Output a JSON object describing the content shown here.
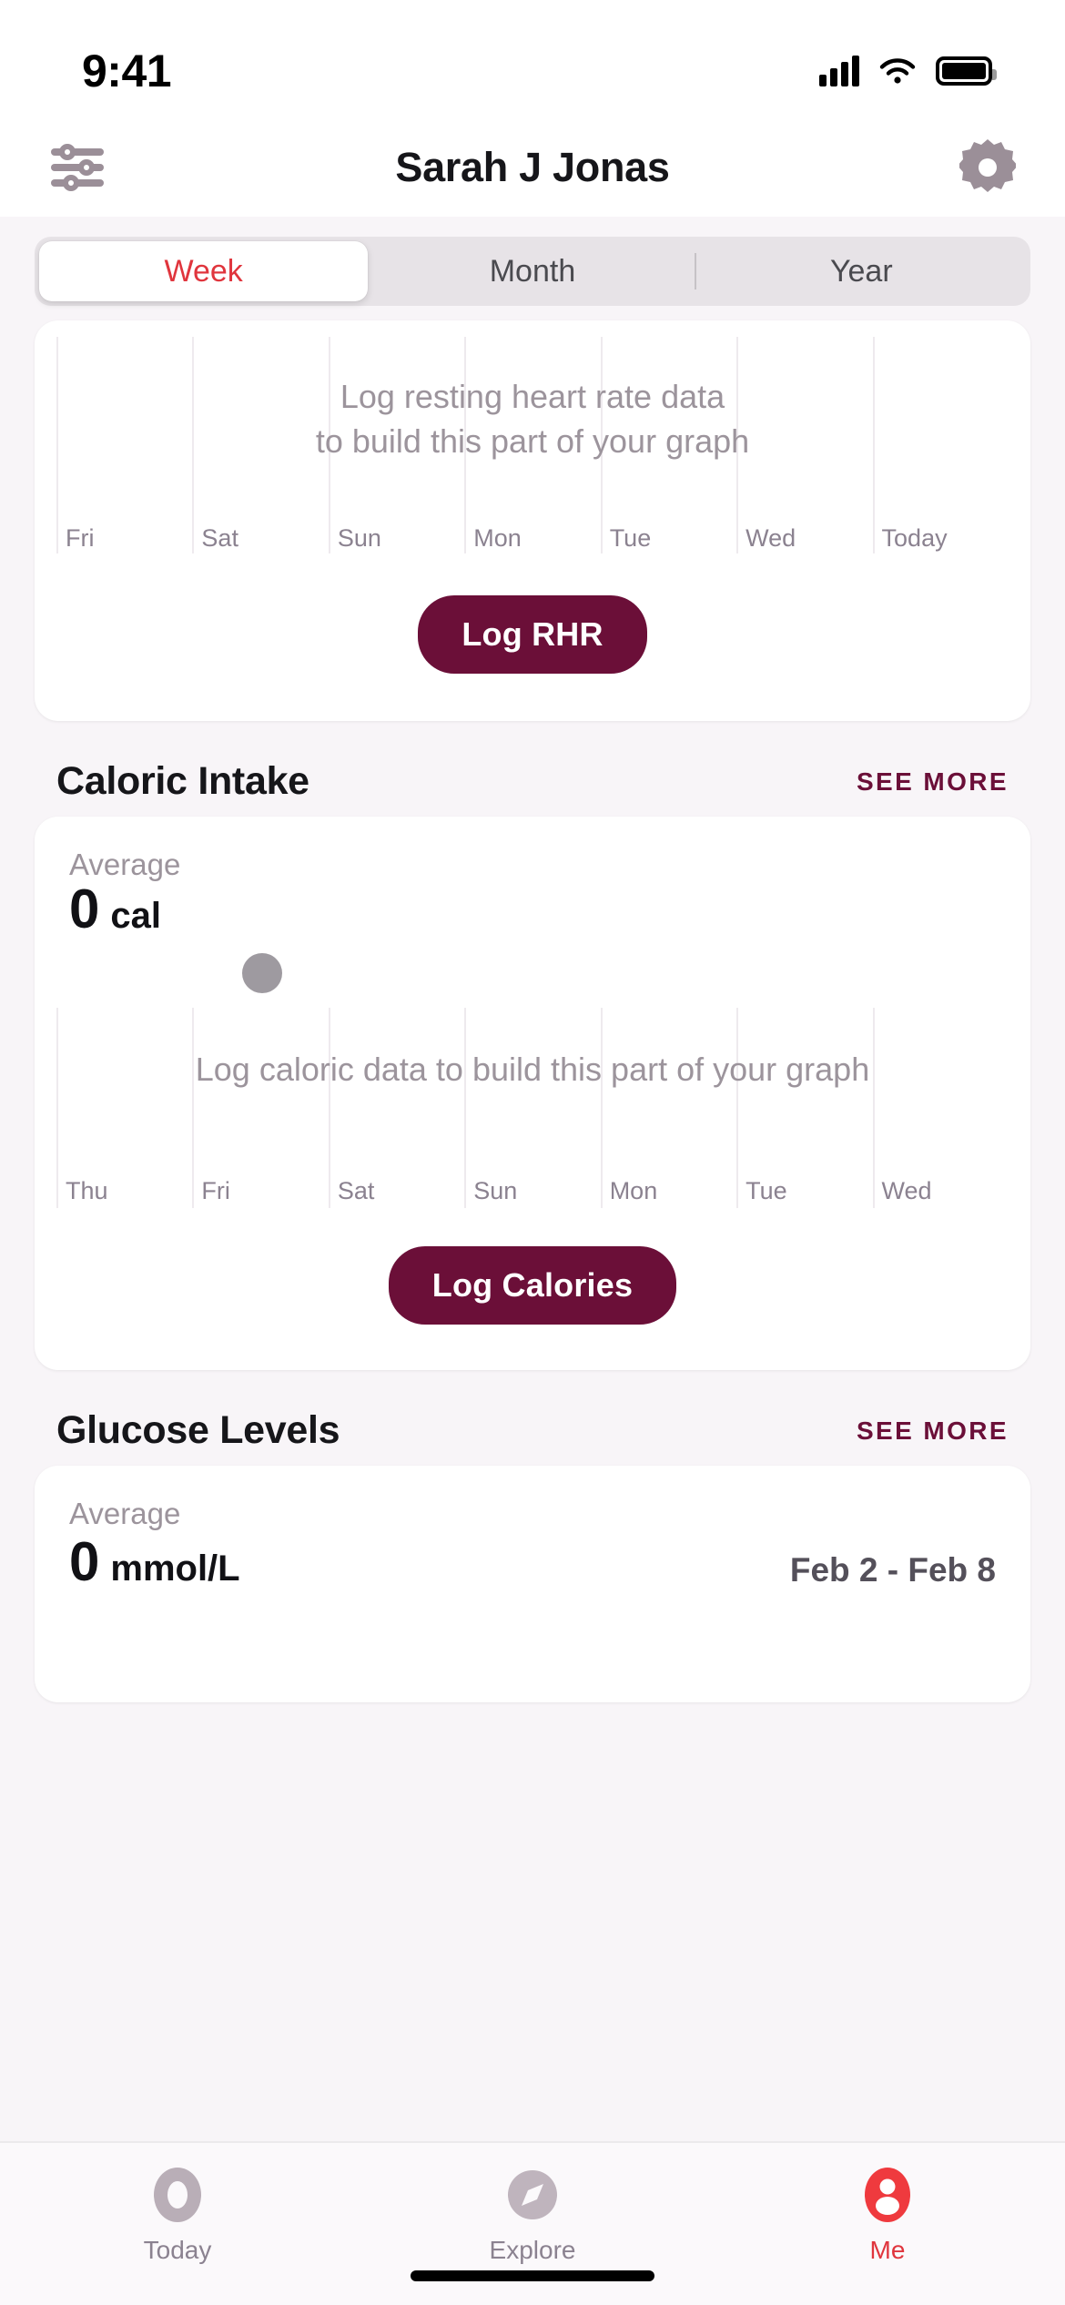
{
  "status_bar": {
    "time": "9:41",
    "signal_icon": "cellular-signal-icon",
    "wifi_icon": "wifi-icon",
    "battery_icon": "battery-icon"
  },
  "nav_bar": {
    "filter_icon": "filter-sliders-icon",
    "title": "Sarah J Jonas",
    "settings_icon": "gear-icon"
  },
  "segmented_control": {
    "options": [
      {
        "label": "Week",
        "active": true
      },
      {
        "label": "Month",
        "active": false
      },
      {
        "label": "Year",
        "active": false
      }
    ],
    "active_color": "#e0353d",
    "inactive_color": "#4a4a4f",
    "track_color": "#e7e3e7"
  },
  "cards": [
    {
      "id": "resting-heart-rate",
      "empty_message_line1": "Log resting heart rate data",
      "empty_message_line2": "to build this part of your graph",
      "day_labels": [
        "Fri",
        "Sat",
        "Sun",
        "Mon",
        "Tue",
        "Wed",
        "Today"
      ],
      "button_label": "Log RHR"
    }
  ],
  "caloric_intake": {
    "section_title": "Caloric Intake",
    "see_more_label": "SEE MORE",
    "average_label": "Average",
    "average_value": "0",
    "average_unit": "cal",
    "empty_message": "Log caloric data to build this part of your graph",
    "day_labels": [
      "Thu",
      "Fri",
      "Sat",
      "Sun",
      "Mon",
      "Tue",
      "Wed"
    ],
    "button_label": "Log Calories"
  },
  "glucose_levels": {
    "section_title": "Glucose Levels",
    "see_more_label": "SEE MORE",
    "average_label": "Average",
    "average_value": "0",
    "average_unit": "mmol/L",
    "date_range": "Feb 2 - Feb 8"
  },
  "tab_bar": {
    "tabs": [
      {
        "label": "Today",
        "icon": "ring-icon",
        "active": false
      },
      {
        "label": "Explore",
        "icon": "compass-icon",
        "active": false
      },
      {
        "label": "Me",
        "icon": "person-circle-icon",
        "active": true
      }
    ],
    "active_color": "#e0353d",
    "inactive_color": "#b3a9b3"
  },
  "theme": {
    "accent_maroon": "#6b0f38",
    "accent_red": "#e0353d",
    "page_background": "#f8f5f8",
    "card_background": "#ffffff",
    "muted_text": "#9c949c"
  },
  "chart_data": [
    {
      "type": "line",
      "title": "Resting Heart Rate",
      "categories": [
        "Fri",
        "Sat",
        "Sun",
        "Mon",
        "Tue",
        "Wed",
        "Today"
      ],
      "values": [
        null,
        null,
        null,
        null,
        null,
        null,
        null
      ],
      "xlabel": "",
      "ylabel": "",
      "grid": true,
      "empty_state": true,
      "empty_message": "Log resting heart rate data to build this part of your graph"
    },
    {
      "type": "line",
      "title": "Caloric Intake",
      "categories": [
        "Thu",
        "Fri",
        "Sat",
        "Sun",
        "Mon",
        "Tue",
        "Wed"
      ],
      "values": [
        null,
        null,
        null,
        null,
        null,
        null,
        null
      ],
      "average": 0,
      "unit": "cal",
      "xlabel": "",
      "ylabel": "",
      "grid": true,
      "empty_state": true,
      "empty_message": "Log caloric data to build this part of your graph"
    },
    {
      "type": "line",
      "title": "Glucose Levels",
      "categories": [],
      "values": [],
      "average": 0,
      "unit": "mmol/L",
      "date_range": "Feb 2 - Feb 8",
      "grid": true,
      "empty_state": true
    }
  ]
}
